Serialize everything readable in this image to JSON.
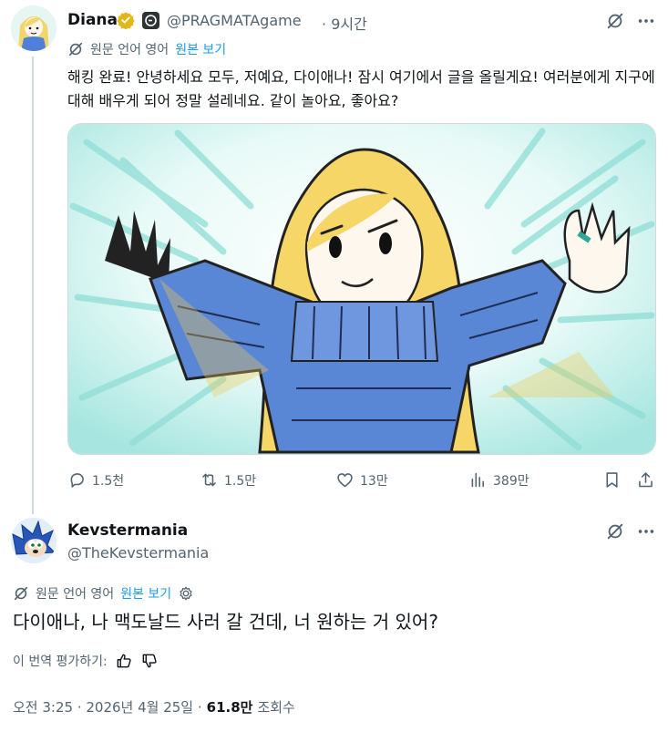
{
  "tweet": {
    "author_name": "Diana",
    "handle": "@PRAGMATAgame",
    "separator": "·",
    "time_ago": "9시간",
    "translation_note": "원문 언어 영어",
    "show_original": "원본 보기",
    "text": "해킹 완료! 안녕하세요 모두, 저예요, 다이애나! 잠시 여기에서 글을 올릴게요! 여러분에게 지구에 대해 배우게 되어 정말 설레네요. 같이 놀아요, 좋아요?",
    "stats": {
      "replies": "1.5천",
      "reposts": "1.5만",
      "likes": "13만",
      "views": "389만"
    }
  },
  "reply": {
    "author_name": "Kevstermania",
    "handle": "@TheKevstermania",
    "translation_note": "원문 언어 영어",
    "show_original": "원본 보기",
    "text": "다이애나, 나 맥도날드 사러 갈 건데, 너 원하는 거 있어?",
    "rate_translation": "이 번역 평가하기:",
    "timestamp": "오전 3:25 · 2026년 4월 25일 ·",
    "view_count": "61.8만",
    "view_label": "조회수"
  },
  "colors": {
    "accent": "#1d9bf0",
    "muted": "#536471",
    "verified_gold": "#e2b719"
  },
  "icons": [
    "verified-gold-icon",
    "affiliate-badge-icon",
    "grok-icon",
    "more-icon",
    "translate-icon",
    "reply-icon",
    "repost-icon",
    "like-icon",
    "views-icon",
    "bookmark-icon",
    "share-icon",
    "thumbs-up-icon",
    "thumbs-down-icon",
    "gear-icon"
  ]
}
